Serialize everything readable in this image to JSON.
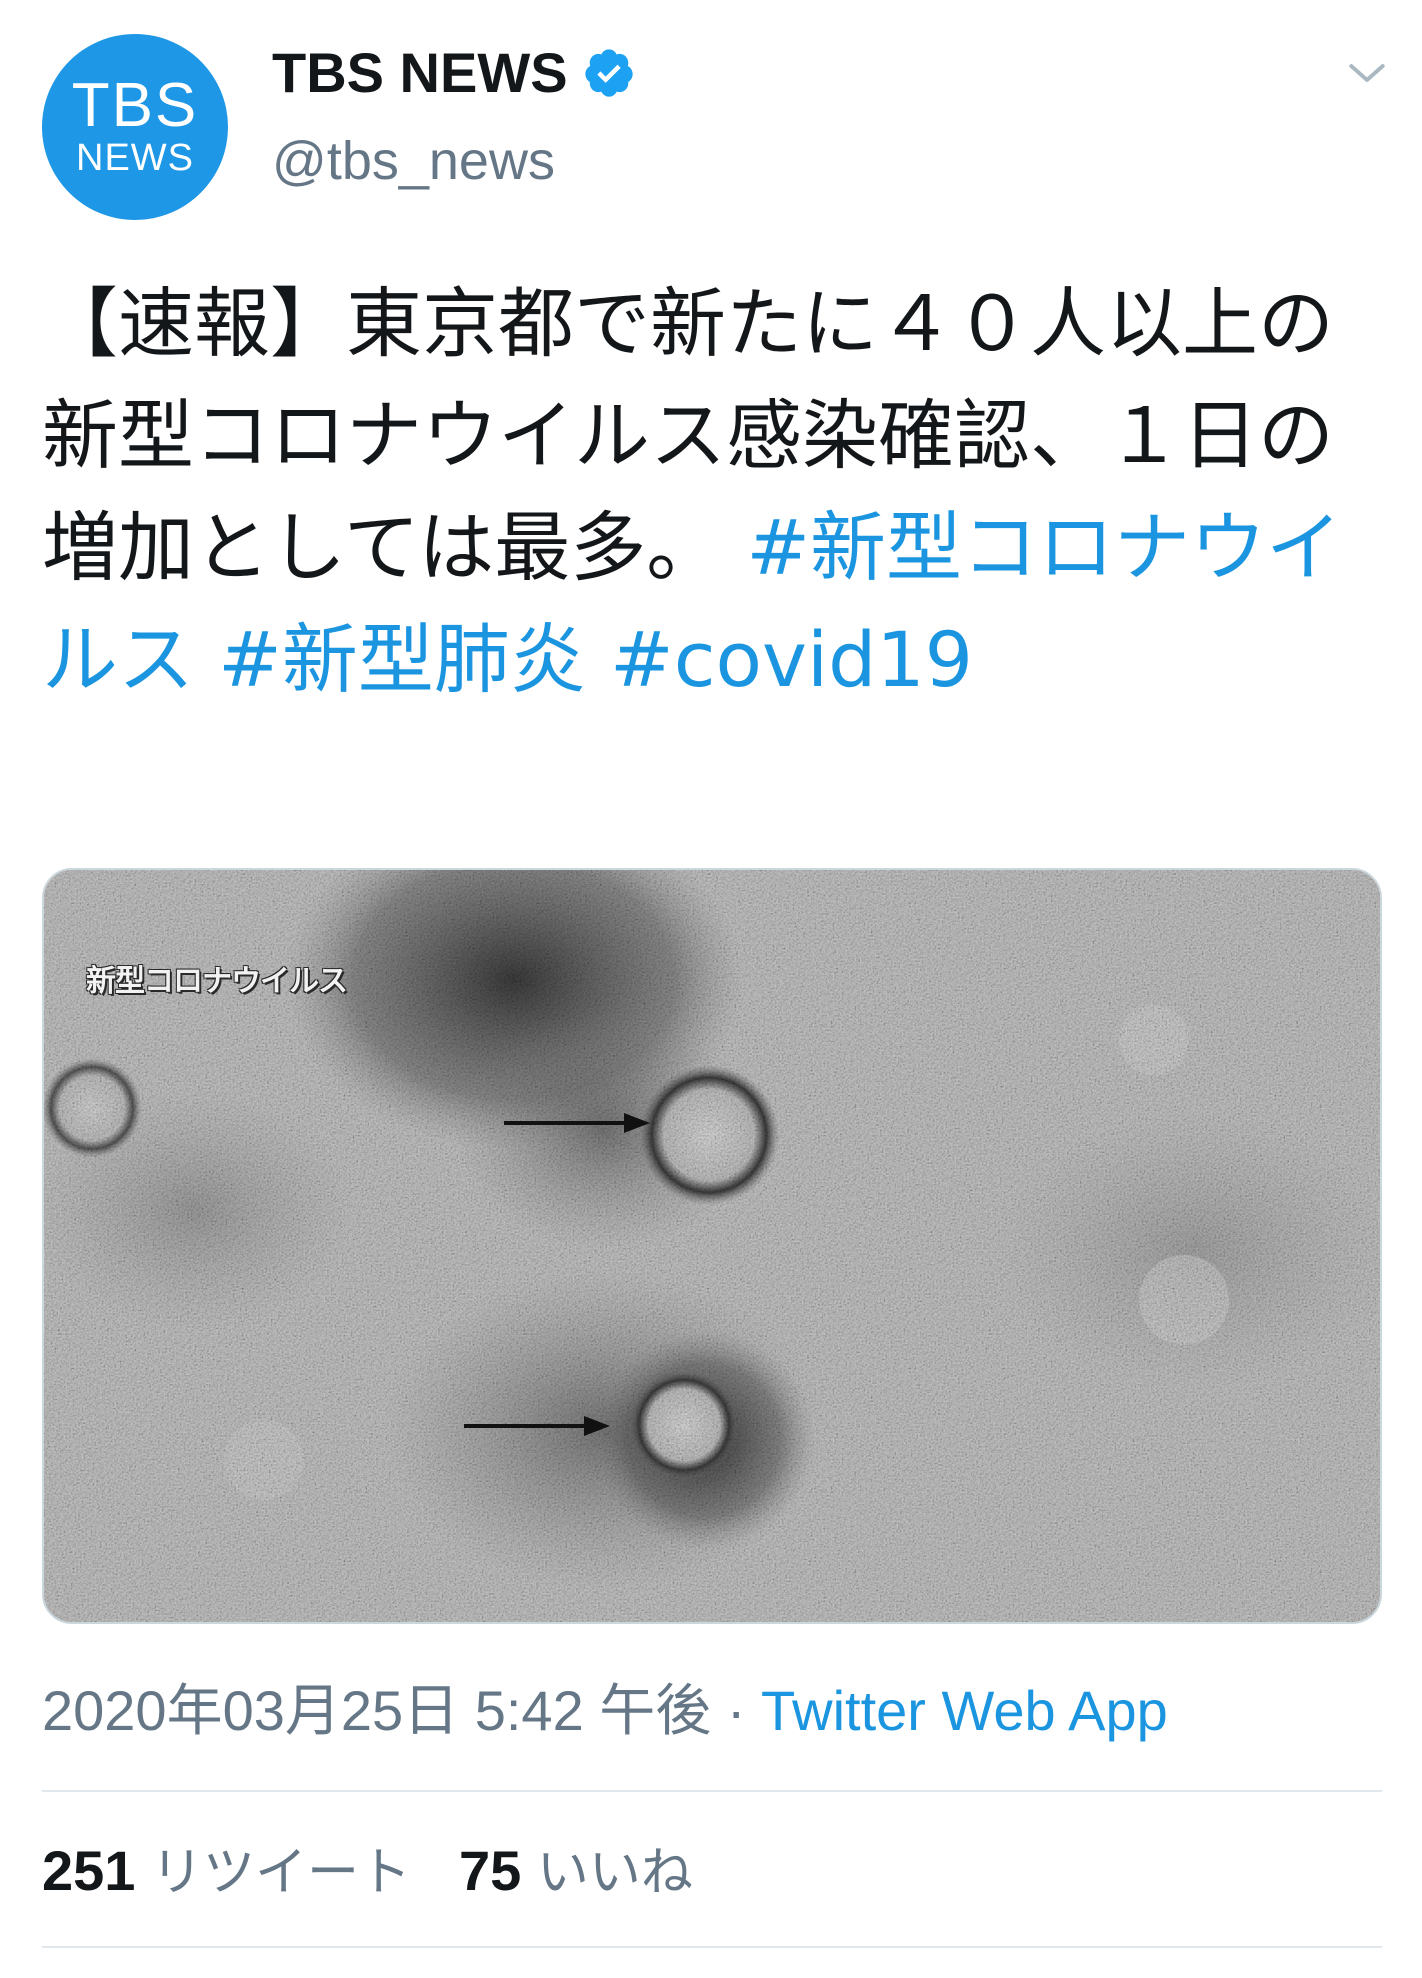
{
  "author": {
    "avatar_top": "TBS",
    "avatar_bottom": "NEWS",
    "display_name": "TBS NEWS",
    "handle": "@tbs_news",
    "verified": true
  },
  "tweet": {
    "text": "【速報】東京都で新たに４０人以上の新型コロナウイルス感染確認、１日の増加としては最多。",
    "hashtags": [
      "#新型コロナウイルス",
      "#新型肺炎",
      "#covid19"
    ]
  },
  "media": {
    "caption": "新型コロナウイルス"
  },
  "meta": {
    "timestamp": "2020年03月25日 5:42 午後",
    "separator": " · ",
    "source": "Twitter Web App"
  },
  "stats": {
    "retweets_count": "251",
    "retweets_label": "リツイート",
    "likes_count": "75",
    "likes_label": "いいね"
  },
  "colors": {
    "avatar": "#1d97e6",
    "link": "#1b95e0",
    "secondary_text": "#657786"
  },
  "icons": [
    "verified-badge-icon",
    "chevron-down-icon"
  ]
}
